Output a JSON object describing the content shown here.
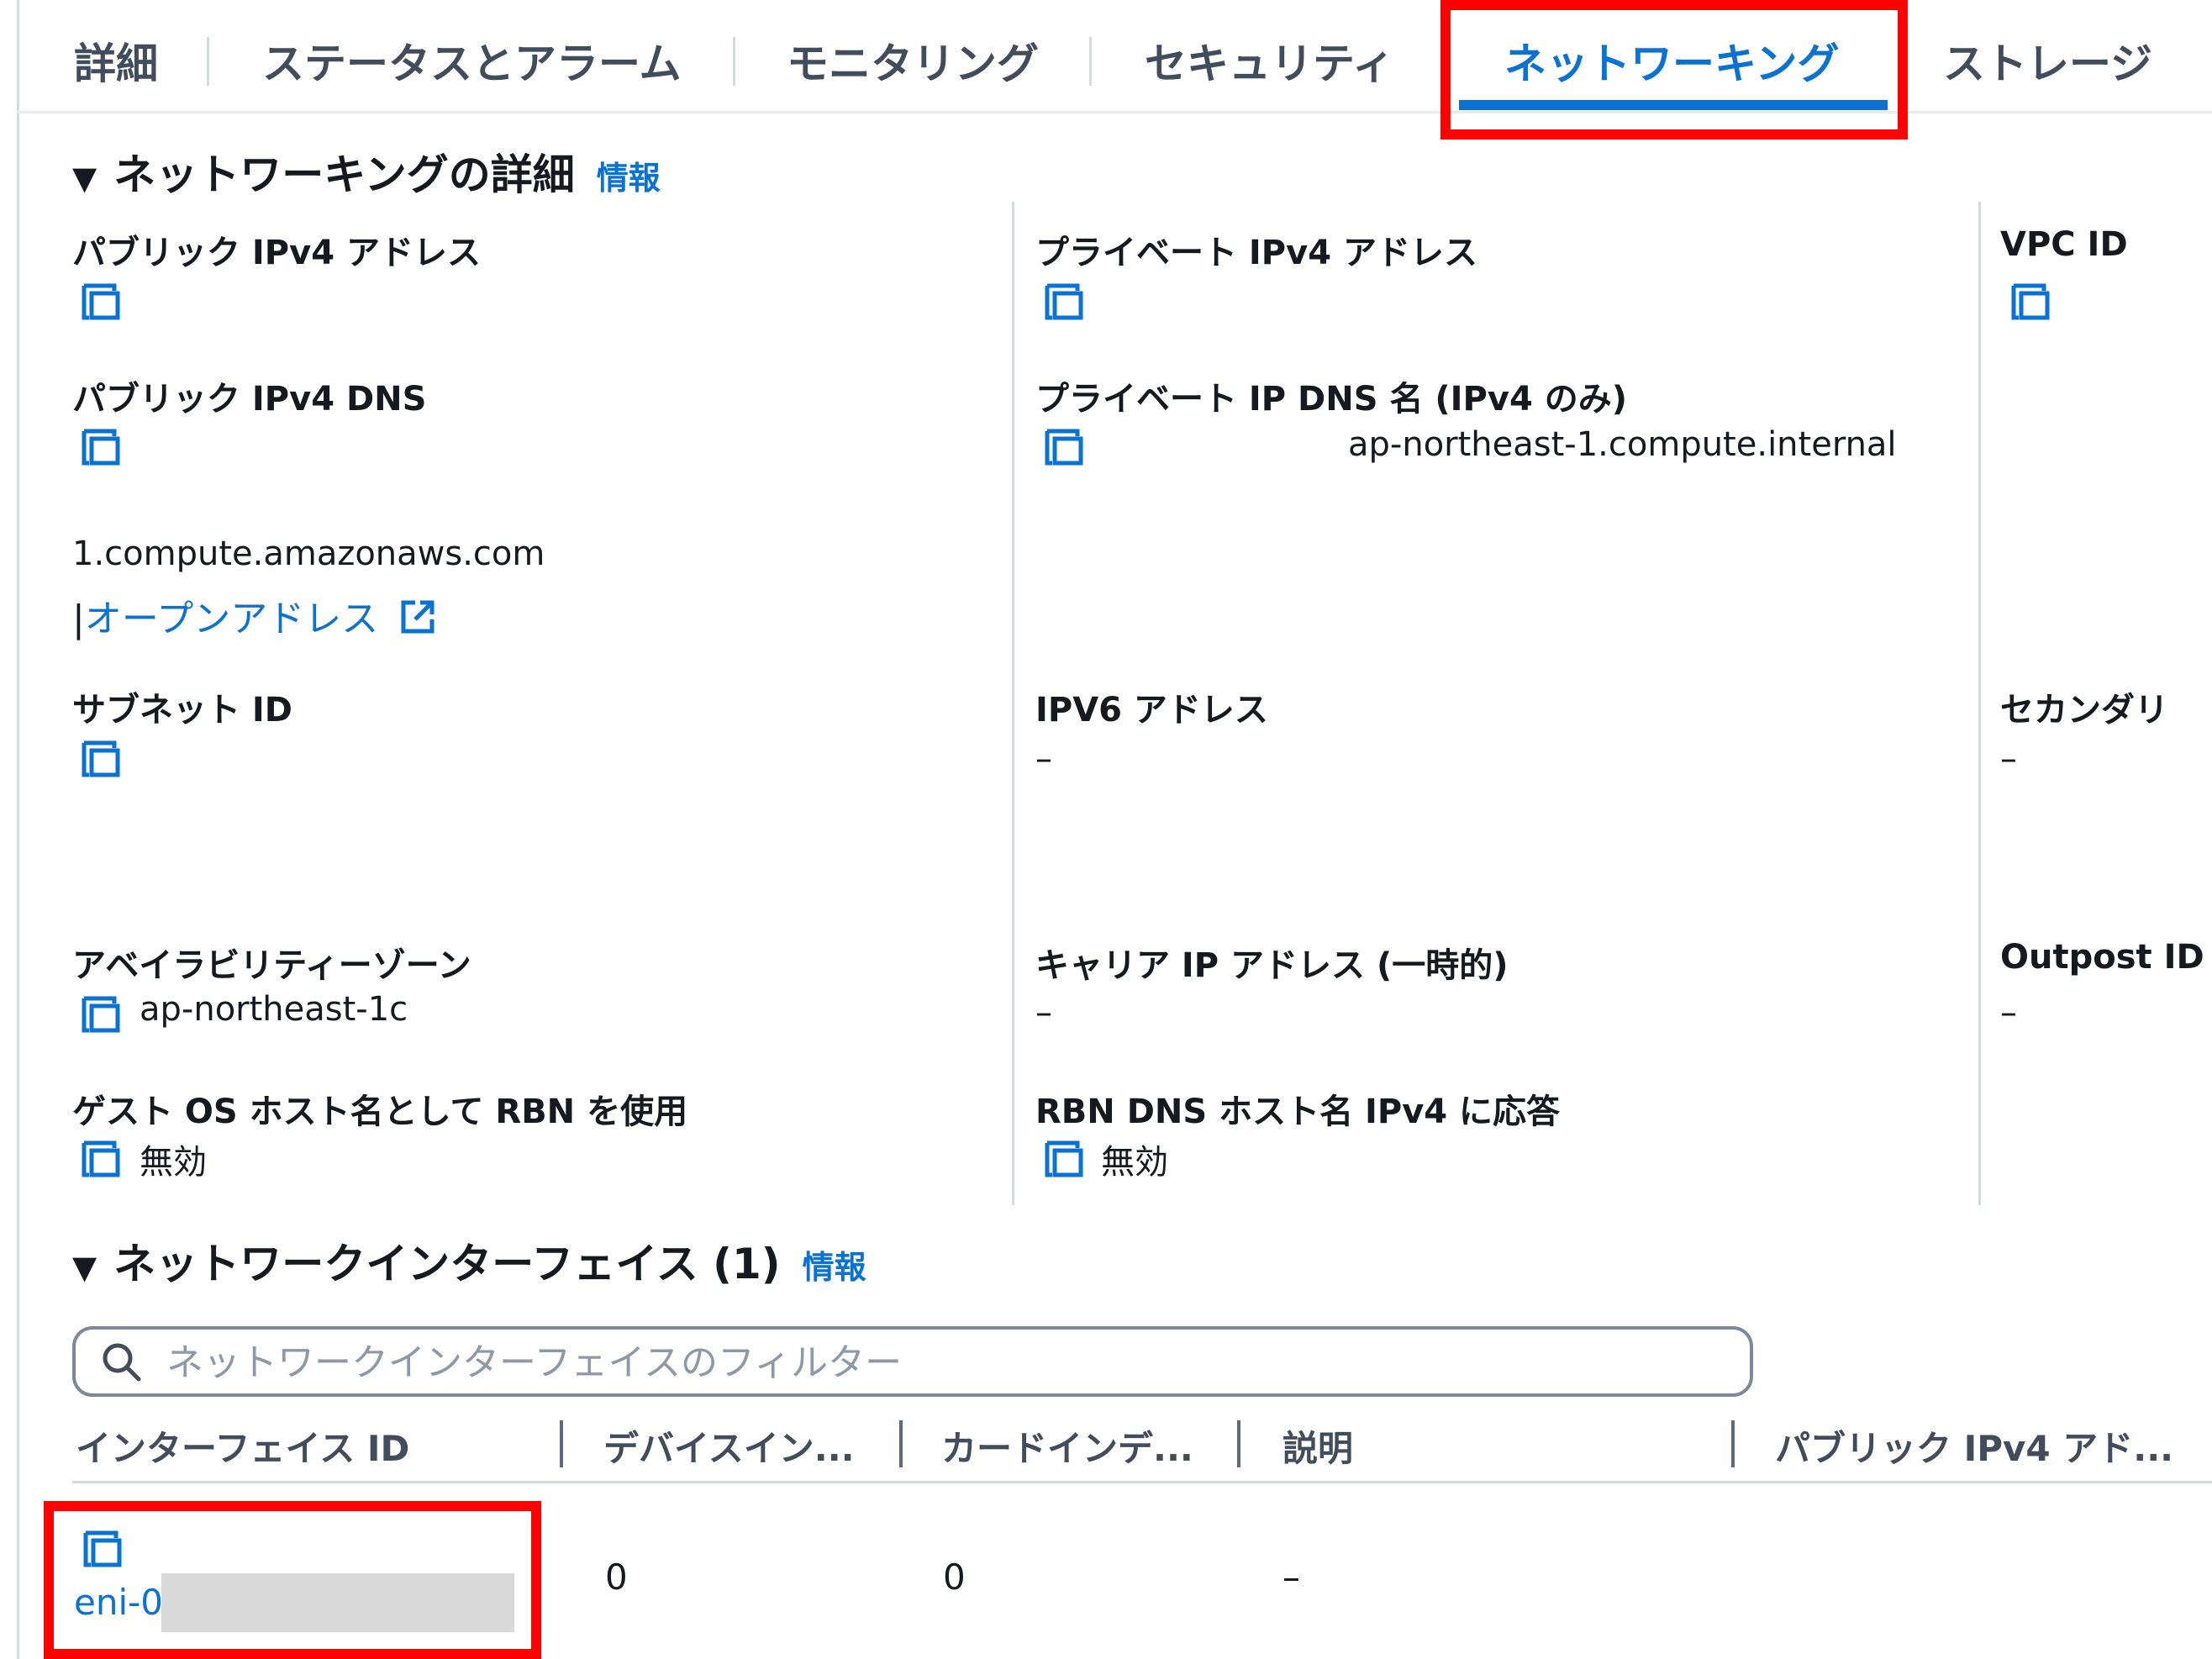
{
  "tabs": [
    "詳細",
    "ステータスとアラーム",
    "モニタリング",
    "セキュリティ",
    "ネットワーキング",
    "ストレージ"
  ],
  "active_tab": "ネットワーキング",
  "networking_details": {
    "title": "ネットワーキングの詳細",
    "info": "情報",
    "public_ipv4_address": {
      "label": "パブリック IPv4 アドレス"
    },
    "private_ipv4_address": {
      "label": "プライベート IPv4 アドレス"
    },
    "vpc_id": {
      "label": "VPC ID"
    },
    "public_ipv4_dns": {
      "label": "パブリック IPv4 DNS",
      "value": "1.compute.amazonaws.com",
      "separator": "|",
      "open_link": "オープンアドレス"
    },
    "private_ip_dns_name": {
      "label": "プライベート IP DNS 名 (IPv4 のみ)",
      "value": "ap-northeast-1.compute.internal"
    },
    "subnet_id": {
      "label": "サブネット ID"
    },
    "ipv6_address": {
      "label": "IPV6 アドレス",
      "value": "–"
    },
    "secondary": {
      "label": "セカンダリ",
      "value": "–"
    },
    "availability_zone": {
      "label": "アベイラビリティーゾーン",
      "value": "ap-northeast-1c"
    },
    "carrier_ip": {
      "label": "キャリア IP アドレス (一時的)",
      "value": "–"
    },
    "outpost_id": {
      "label": "Outpost ID",
      "value": "–"
    },
    "guest_os_rbn": {
      "label": "ゲスト OS ホスト名として RBN を使用",
      "value": "無効"
    },
    "rbn_dns_ipv4": {
      "label": "RBN DNS ホスト名 IPv4 に応答",
      "value": "無効"
    }
  },
  "network_interfaces": {
    "title": "ネットワークインターフェイス (1)",
    "info": "情報",
    "search_placeholder": "ネットワークインターフェイスのフィルター",
    "columns": [
      "インターフェイス ID",
      "デバイスイン...",
      "カードインデ...",
      "説明",
      "パブリック IPv4 アド..."
    ],
    "rows": [
      {
        "interface_id": "eni-0",
        "device_index": "0",
        "card_index": "0",
        "description": "–"
      }
    ]
  },
  "colors": {
    "accent": "#0972d3",
    "highlight": "#ff0000",
    "text": "#16191f",
    "muted": "#414d5c"
  }
}
